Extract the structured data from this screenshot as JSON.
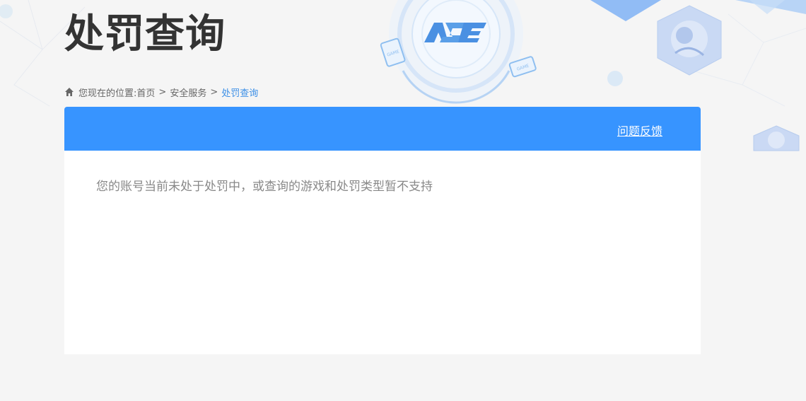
{
  "header": {
    "title": "处罚查询",
    "logo_text": "ACE",
    "badge_text": "GAME"
  },
  "breadcrumb": {
    "prefix": "您现在的位置:",
    "items": [
      {
        "label": "首页"
      },
      {
        "label": "安全服务"
      },
      {
        "label": "处罚查询"
      }
    ],
    "separator": ">"
  },
  "card": {
    "feedback_label": "问题反馈",
    "notice": "您的账号当前未处于处罚中，或查询的游戏和处罚类型暂不支持"
  },
  "colors": {
    "accent": "#3794ff",
    "breadcrumb_current": "#3a8ee6",
    "background": "#f5f5f5"
  }
}
